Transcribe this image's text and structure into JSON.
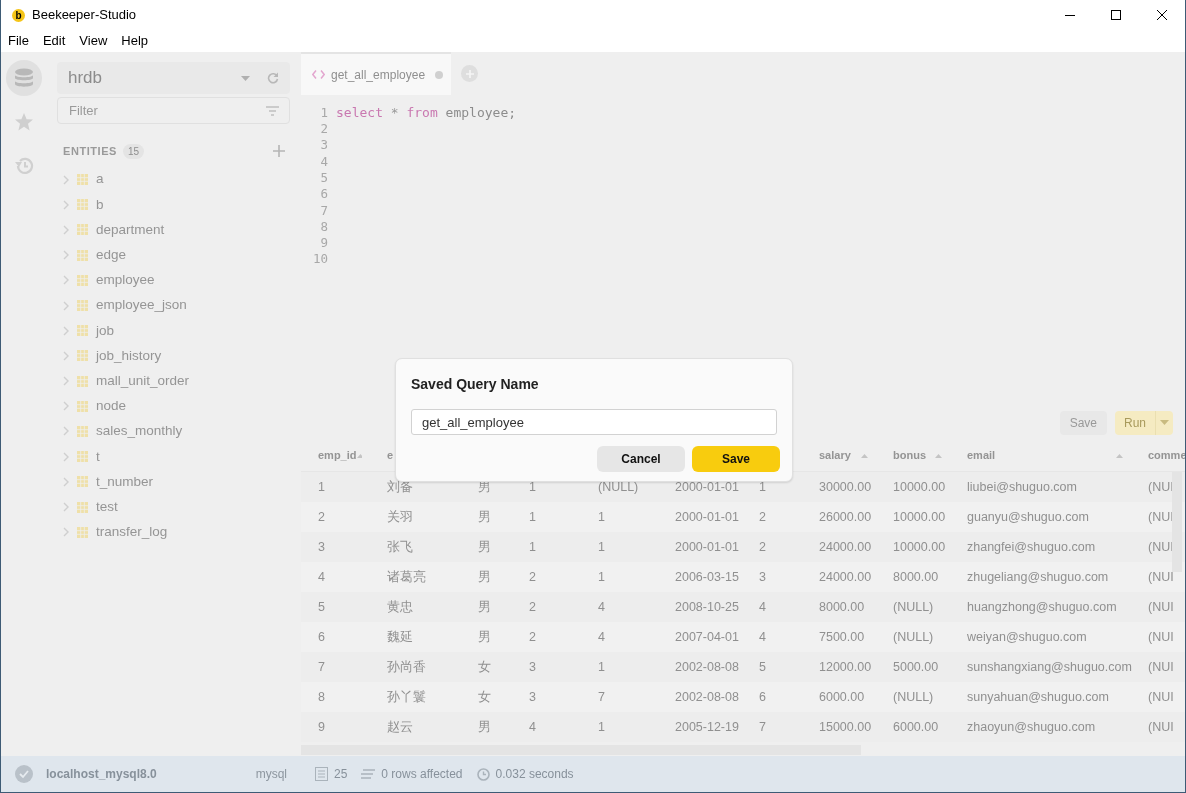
{
  "window": {
    "logo": "b",
    "title": "Beekeeper-Studio"
  },
  "menu": [
    "File",
    "Edit",
    "View",
    "Help"
  ],
  "rail": [
    {
      "kind": "database",
      "selected": true
    },
    {
      "kind": "favorites",
      "selected": false
    },
    {
      "kind": "history",
      "selected": false
    }
  ],
  "sidebar": {
    "database": "hrdb",
    "filter_placeholder": "Filter",
    "entities_label": "ENTITIES",
    "entities_count": "15",
    "tables": [
      "a",
      "b",
      "department",
      "edge",
      "employee",
      "employee_json",
      "job",
      "job_history",
      "mall_unit_order",
      "node",
      "sales_monthly",
      "t",
      "t_number",
      "test",
      "transfer_log"
    ]
  },
  "editor": {
    "tabs": [
      {
        "title": "get_all_employee",
        "unsaved": true,
        "selected": true
      }
    ],
    "lines": [
      {
        "number": "1",
        "tokens": [
          {
            "text": "select",
            "kind": "keyword"
          },
          {
            "text": "*",
            "kind": "operator"
          },
          {
            "text": "from",
            "kind": "keyword"
          },
          {
            "text": "employee;",
            "kind": "plain"
          }
        ]
      },
      {
        "number": "2"
      },
      {
        "number": "3"
      },
      {
        "number": "4"
      },
      {
        "number": "5"
      },
      {
        "number": "6"
      },
      {
        "number": "7"
      },
      {
        "number": "8"
      },
      {
        "number": "9"
      },
      {
        "number": "10"
      }
    ]
  },
  "toolbar": {
    "save": "Save",
    "run": "Run"
  },
  "results": {
    "columns": [
      {
        "label": "emp_id",
        "sort": true
      },
      {
        "label": "e"
      },
      {},
      {},
      {},
      {},
      {},
      {
        "label": "salary",
        "sort": true
      },
      {
        "label": "bonus",
        "sort": true
      },
      {
        "label": "email",
        "sort": true
      },
      {
        "label": "comme"
      }
    ],
    "rows": [
      [
        "1",
        "刘备",
        "男",
        "1",
        "(NULL)",
        "2000-01-01",
        "1",
        "30000.00",
        "10000.00",
        "liubei@shuguo.com",
        "(NUI"
      ],
      [
        "2",
        "关羽",
        "男",
        "1",
        "1",
        "2000-01-01",
        "2",
        "26000.00",
        "10000.00",
        "guanyu@shuguo.com",
        "(NUI"
      ],
      [
        "3",
        "张飞",
        "男",
        "1",
        "1",
        "2000-01-01",
        "2",
        "24000.00",
        "10000.00",
        "zhangfei@shuguo.com",
        "(NUI"
      ],
      [
        "4",
        "诸葛亮",
        "男",
        "2",
        "1",
        "2006-03-15",
        "3",
        "24000.00",
        "8000.00",
        "zhugeliang@shuguo.com",
        "(NUI"
      ],
      [
        "5",
        "黄忠",
        "男",
        "2",
        "4",
        "2008-10-25",
        "4",
        "8000.00",
        "(NULL)",
        "huangzhong@shuguo.com",
        "(NUI"
      ],
      [
        "6",
        "魏延",
        "男",
        "2",
        "4",
        "2007-04-01",
        "4",
        "7500.00",
        "(NULL)",
        "weiyan@shuguo.com",
        "(NUI"
      ],
      [
        "7",
        "孙尚香",
        "女",
        "3",
        "1",
        "2002-08-08",
        "5",
        "12000.00",
        "5000.00",
        "sunshangxiang@shuguo.com",
        "(NUI"
      ],
      [
        "8",
        "孙丫鬟",
        "女",
        "3",
        "7",
        "2002-08-08",
        "6",
        "6000.00",
        "(NULL)",
        "sunyahuan@shuguo.com",
        "(NUI"
      ],
      [
        "9",
        "赵云",
        "男",
        "4",
        "1",
        "2005-12-19",
        "7",
        "15000.00",
        "6000.00",
        "zhaoyun@shuguo.com",
        "(NUI"
      ]
    ]
  },
  "status_bar": {
    "connection": "localhost_mysql8.0",
    "driver": "mysql",
    "row_count": "25",
    "affected": "0 rows affected",
    "duration": "0.032 seconds"
  },
  "dialog": {
    "title": "Saved Query Name",
    "value": "get_all_employee",
    "buttons": [
      {
        "label": "Cancel",
        "kind": "secondary"
      },
      {
        "label": "Save",
        "kind": "primary"
      }
    ]
  }
}
